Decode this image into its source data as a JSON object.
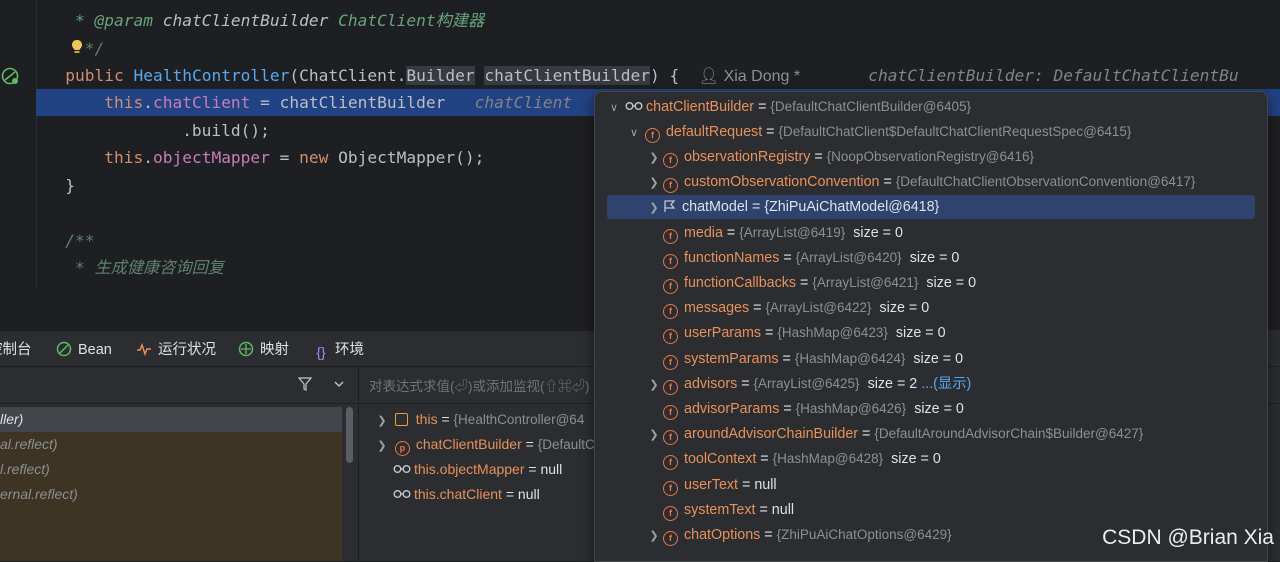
{
  "colors": {
    "editor_bg": "#1e1f22",
    "panel_bg": "#2b2d30",
    "selection": "#214283",
    "keyword": "#cf8e6d",
    "field": "#c77dbb",
    "method": "#56a8f5",
    "var_name": "#e8915a"
  },
  "editor": {
    "line1_tag": "* @param",
    "line1_param": "chatClientBuilder",
    "line1_desc": "ChatClient构建器",
    "line2": "*/",
    "line3": {
      "kw": "public",
      "method": "HealthController",
      "open": "(ChatClient.",
      "builder_type": "Builder",
      "param": "chatClientBuilder",
      "close": ") {",
      "author": "Xia Dong *",
      "hint": "chatClientBuilder: DefaultChatClientBu"
    },
    "line4": {
      "this": "this",
      "field": "chatClient",
      "rest": " = chatClientBuilder",
      "hint": "chatClient"
    },
    "line5": ".build();",
    "line6": {
      "this": "this",
      "field": "objectMapper",
      "eq": " = ",
      "kw": "new",
      "rest": " ObjectMapper();"
    },
    "line7": "}",
    "line8": "/**",
    "line9": "* 生成健康咨询回复"
  },
  "tabs": [
    {
      "label": "控制台",
      "icon": "console-icon"
    },
    {
      "label": "Bean",
      "icon": "bean-icon"
    },
    {
      "label": "运行状况",
      "icon": "health-icon"
    },
    {
      "label": "映射",
      "icon": "mapping-icon"
    },
    {
      "label": "环境",
      "icon": "env-icon"
    }
  ],
  "frames": [
    {
      "text": "ller)",
      "style": "sel"
    },
    {
      "text": "al.reflect)",
      "style": "lib"
    },
    {
      "text": "l.reflect)",
      "style": "lib"
    },
    {
      "text": "ernal.reflect)",
      "style": "lib"
    }
  ],
  "eval_placeholder": "对表达式求值(⏎)或添加监视(⇧⌘⏎)",
  "variables": [
    {
      "icon": "list",
      "name": "this",
      "ref": "{HealthController@64",
      "value": ""
    },
    {
      "icon": "p",
      "name": "chatClientBuilder",
      "ref": "{DefaultC",
      "value": ""
    },
    {
      "icon": "glasses",
      "name": "this.objectMapper",
      "ref": "",
      "value": "null"
    },
    {
      "icon": "glasses",
      "name": "this.chatClient",
      "ref": "",
      "value": "null"
    }
  ],
  "popup": {
    "root": {
      "name": "chatClientBuilder",
      "ref": "{DefaultChatClientBuilder@6405}"
    },
    "child": {
      "name": "defaultRequest",
      "ref": "{DefaultChatClient$DefaultChatClientRequestSpec@6415}"
    },
    "fields": [
      {
        "name": "observationRegistry",
        "ref": "{NoopObservationRegistry@6416}",
        "size": "",
        "expand": true
      },
      {
        "name": "customObservationConvention",
        "ref": "{DefaultChatClientObservationConvention@6417}",
        "size": "",
        "expand": true
      },
      {
        "name": "chatModel",
        "ref": "{ZhiPuAiChatModel@6418}",
        "size": "",
        "expand": true,
        "selected": true
      },
      {
        "name": "media",
        "ref": "{ArrayList@6419}",
        "size": "size = 0",
        "expand": false
      },
      {
        "name": "functionNames",
        "ref": "{ArrayList@6420}",
        "size": "size = 0",
        "expand": false
      },
      {
        "name": "functionCallbacks",
        "ref": "{ArrayList@6421}",
        "size": "size = 0",
        "expand": false
      },
      {
        "name": "messages",
        "ref": "{ArrayList@6422}",
        "size": "size = 0",
        "expand": false
      },
      {
        "name": "userParams",
        "ref": "{HashMap@6423}",
        "size": "size = 0",
        "expand": false
      },
      {
        "name": "systemParams",
        "ref": "{HashMap@6424}",
        "size": "size = 0",
        "expand": false
      },
      {
        "name": "advisors",
        "ref": "{ArrayList@6425}",
        "size": "size = 2",
        "link": "...(显示)",
        "expand": true
      },
      {
        "name": "advisorParams",
        "ref": "{HashMap@6426}",
        "size": "size = 0",
        "expand": false
      },
      {
        "name": "aroundAdvisorChainBuilder",
        "ref": "{DefaultAroundAdvisorChain$Builder@6427}",
        "size": "",
        "expand": true
      },
      {
        "name": "toolContext",
        "ref": "{HashMap@6428}",
        "size": "size = 0",
        "expand": false
      },
      {
        "name": "userText",
        "ref": "",
        "value": "null",
        "size": "",
        "expand": false
      },
      {
        "name": "systemText",
        "ref": "",
        "value": "null",
        "size": "",
        "expand": false
      },
      {
        "name": "chatOptions",
        "ref": "{ZhiPuAiChatOptions@6429}",
        "size": "",
        "expand": true
      }
    ]
  },
  "watermark": "CSDN @Brian Xia"
}
